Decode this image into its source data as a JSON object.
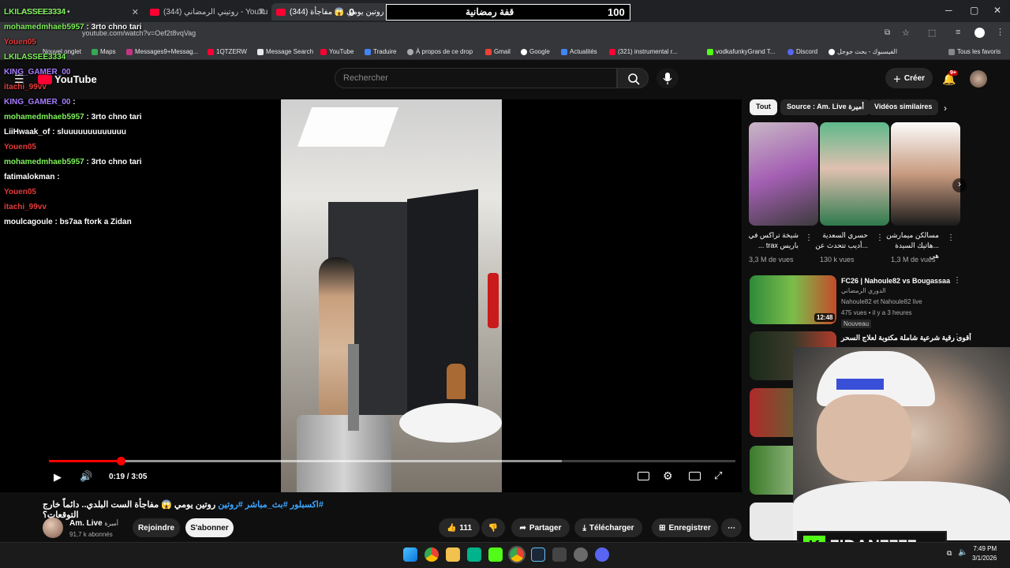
{
  "browser": {
    "tabs": [
      {
        "label": "LKILASSEE3334 •"
      },
      {
        "label": "(344) روتيني الرمضاني - YouTube"
      },
      {
        "label": "(344) روتين يومي 😱 مفاجأة"
      }
    ],
    "new_tab_label": "+",
    "url": "youtube.com/watch?v=Oef2t8vqVag",
    "bookmarks": [
      "Nouvel onglet",
      "Maps",
      "Messages9+Messag...",
      "1QTZERW",
      "Message Search",
      "YouTube",
      "Traduire",
      "À propos de ce drop",
      "Gmail",
      "Google",
      "Actualités",
      "(321) instrumental r...",
      "vodkafunkyGrand T...",
      "Discord",
      "الفيسبوك - بحث جوجل"
    ],
    "all_bookmarks": "Tous les favoris"
  },
  "overlay": {
    "left_num": "0",
    "title": "قفة رمضانية",
    "right_num": "100"
  },
  "youtube": {
    "logo": "YouTube",
    "search_placeholder": "Rechercher",
    "create_label": "Créer",
    "notif_count": "9+",
    "time_current": "0:19",
    "time_sep": "/",
    "time_total": "3:05",
    "progress_fraction": 0.105,
    "title_tags": "#اكسبلور #بث_مباشر #روتين",
    "title_text": "روتين يومي 😱 مفاجأة الست البلدي.. دائماً خارج التوقعات؟",
    "channel_name": "Am. Live",
    "channel_name_ar": "أميرة",
    "subscribers": "91,7 k abonnés",
    "join_label": "Rejoindre",
    "subscribe_label": "S'abonner",
    "likes": "111",
    "share_label": "Partager",
    "download_label": "Télécharger",
    "save_label": "Enregistrer",
    "chips": [
      "Tout",
      "Source : Am. Live أميرة",
      "Vidéos similaires"
    ],
    "shorts": [
      {
        "title": "شيخة تراكس في باريس trax ...",
        "views": "3,3 M de vues"
      },
      {
        "title": "حسري السعدية ...أديب تتحدث عن",
        "views": "130 k vues"
      },
      {
        "title": "مسالكن ميمارشن ...هاتيك السيدة هي",
        "views": "1,3 M de vues"
      }
    ],
    "related": [
      {
        "title": "FC26 | Nahoule82 vs Bougassaa",
        "channel": "الدوري الرمضاني",
        "meta1": "Nahoule82 et Nahoule82 live",
        "meta2": "475 vues • il y a 3 heures",
        "badge": "Nouveau",
        "duration": "12:48"
      },
      {
        "title": "أقوى رقية شرعية شاملة مكتوبة لعلاج السحر",
        "channel": "",
        "meta1": "",
        "meta2": "",
        "badge": "",
        "duration": "3:"
      },
      {
        "title": "",
        "channel": "",
        "meta1": "",
        "meta2": "",
        "badge": "",
        "duration": ""
      },
      {
        "title": "",
        "channel": "",
        "meta1": "",
        "meta2": "",
        "badge": "",
        "duration": ""
      }
    ]
  },
  "chat": [
    {
      "user": "LKILASSEE3334",
      "color": "green",
      "msg": ""
    },
    {
      "user": "mohamedmhaeb5957",
      "color": "green",
      "msg": ": 3rto chno tari"
    },
    {
      "user": "Youen05",
      "color": "red",
      "msg": ""
    },
    {
      "user": "LKILASSEE3334",
      "color": "green",
      "msg": ""
    },
    {
      "user": "KING_GAMER_00",
      "color": "violet",
      "msg": ""
    },
    {
      "user": "itachi_99vv",
      "color": "red",
      "msg": ""
    },
    {
      "user": "KING_GAMER_00",
      "color": "violet",
      "msg": ":"
    },
    {
      "user": "mohamedmhaeb5957",
      "color": "green",
      "msg": ": 3rto chno tari"
    },
    {
      "user": "LiiHwaak_of",
      "color": "white",
      "msg": ": sluuuuuuuuuuuuu"
    },
    {
      "user": "Youen05",
      "color": "red",
      "msg": ""
    },
    {
      "user": "mohamedmhaeb5957",
      "color": "green",
      "msg": ": 3rto chno tari"
    },
    {
      "user": "fatimalokman",
      "color": "white",
      "msg": ":"
    },
    {
      "user": "Youen05",
      "color": "red",
      "msg": ""
    },
    {
      "user": "itachi_99vv",
      "color": "red",
      "msg": ""
    },
    {
      "user": "moulcagoule",
      "color": "white",
      "msg": ": bs7aa ftork a Zidan"
    }
  ],
  "streamer": {
    "name": "7IDAN7777",
    "logo": "K"
  },
  "taskbar": {
    "time": "7:49 PM",
    "date": "3/1/2026"
  },
  "colors": {
    "youtube_red": "#ff0033",
    "kick_green": "#53fc18",
    "link_blue": "#3ea6ff"
  }
}
